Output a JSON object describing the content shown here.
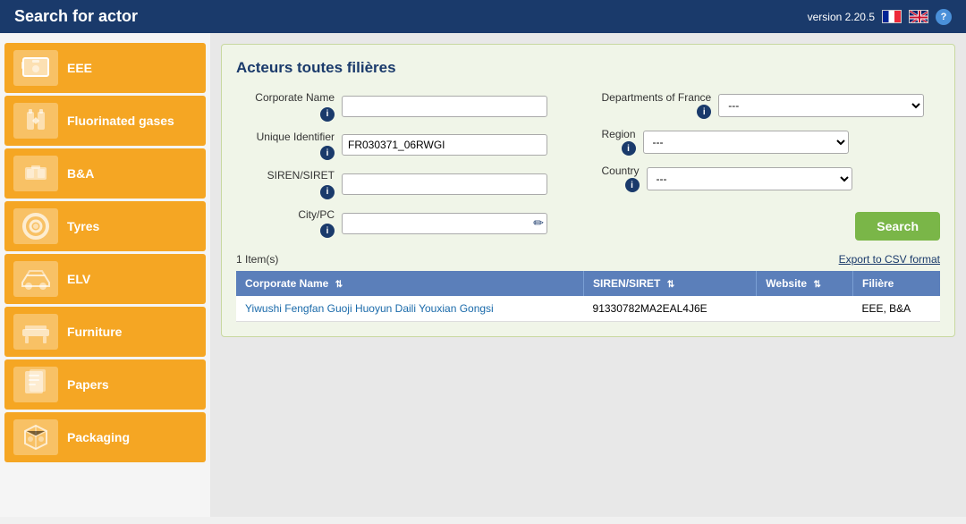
{
  "header": {
    "title": "Search for actor",
    "version": "version 2.20.5"
  },
  "sidebar": {
    "items": [
      {
        "id": "eee",
        "label": "EEE",
        "icon": "🖥"
      },
      {
        "id": "fluorinated-gases",
        "label": "Fluorinated gases",
        "icon": "🔥"
      },
      {
        "id": "bna",
        "label": "B&A",
        "icon": "🔋"
      },
      {
        "id": "tyres",
        "label": "Tyres",
        "icon": "⭕"
      },
      {
        "id": "elv",
        "label": "ELV",
        "icon": "🚗"
      },
      {
        "id": "furniture",
        "label": "Furniture",
        "icon": "🛋"
      },
      {
        "id": "papers",
        "label": "Papers",
        "icon": "📄"
      },
      {
        "id": "packaging",
        "label": "Packaging",
        "icon": "📦"
      }
    ]
  },
  "panel": {
    "title": "Acteurs toutes filières"
  },
  "form": {
    "corporate_name_label": "Corporate Name",
    "corporate_name_value": "",
    "corporate_name_placeholder": "",
    "unique_identifier_label": "Unique Identifier",
    "unique_identifier_value": "FR030371_06RWGI",
    "siren_siret_label": "SIREN/SIRET",
    "siren_siret_value": "",
    "city_pc_label": "City/PC",
    "city_pc_value": "",
    "departments_label": "Departments of France",
    "departments_value": "---",
    "departments_options": [
      "---"
    ],
    "region_label": "Region",
    "region_value": "---",
    "region_options": [
      "---"
    ],
    "country_label": "Country",
    "country_value": "---",
    "country_options": [
      "---"
    ],
    "search_button": "Search"
  },
  "results": {
    "count_text": "1 Item(s)",
    "export_link": "Export to CSV format",
    "columns": [
      {
        "key": "corporate_name",
        "label": "Corporate Name"
      },
      {
        "key": "siren_siret",
        "label": "SIREN/SIRET"
      },
      {
        "key": "website",
        "label": "Website"
      },
      {
        "key": "filiere",
        "label": "Filière"
      }
    ],
    "rows": [
      {
        "corporate_name": "Yiwushi Fengfan Guoji Huoyun Daili Youxian Gongsi",
        "siren_siret": "91330782MA2EAL4J6E",
        "website": "",
        "filiere": "EEE, B&A"
      }
    ]
  }
}
